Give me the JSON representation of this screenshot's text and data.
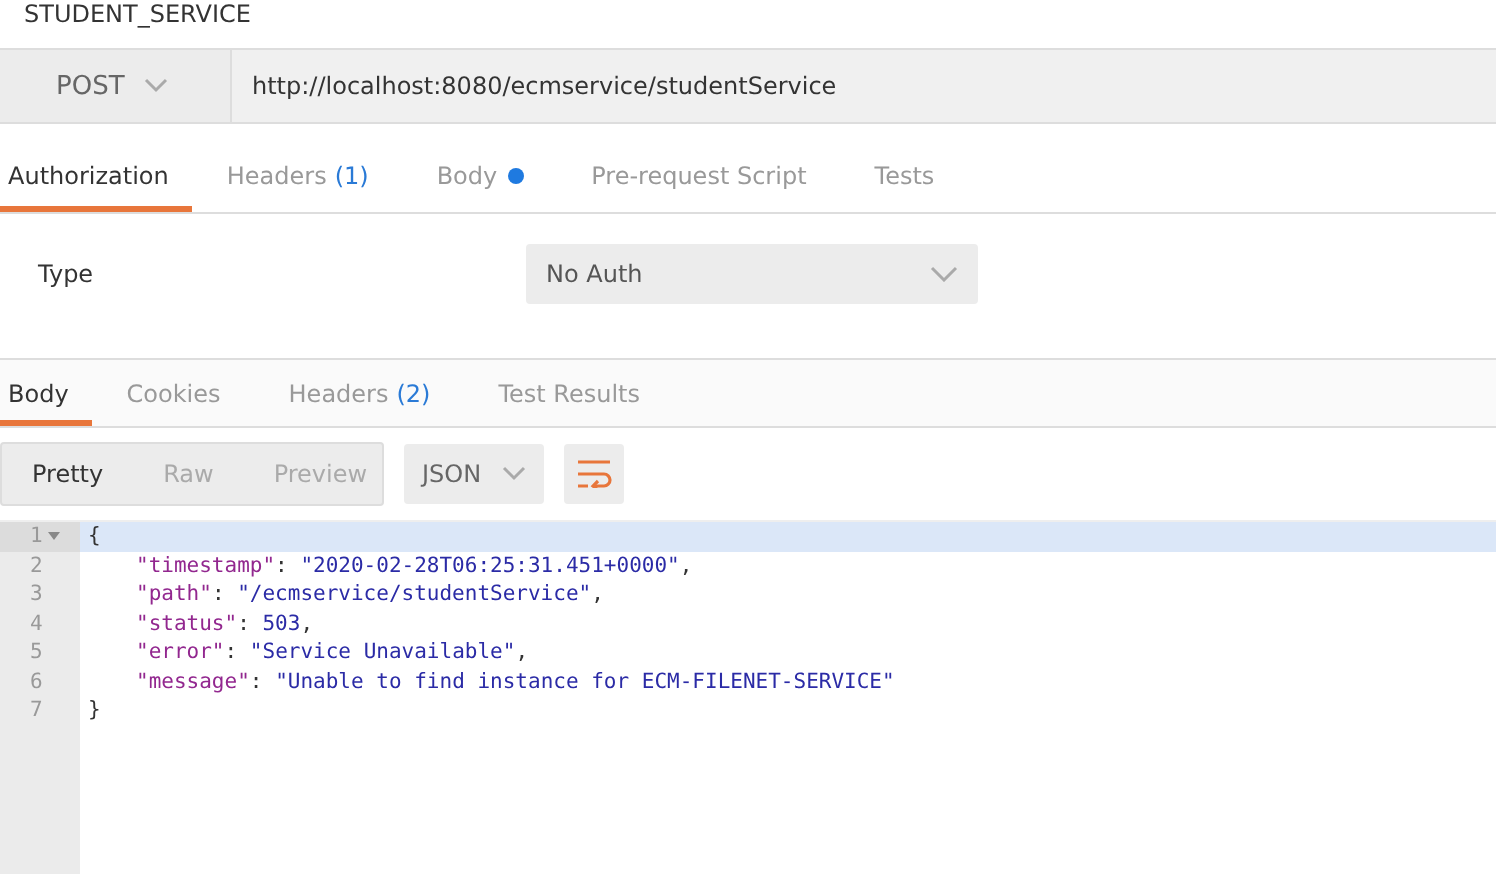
{
  "request_title": "STUDENT_SERVICE",
  "method": "POST",
  "url": "http://localhost:8080/ecmservice/studentService",
  "request_tabs": [
    {
      "label": "Authorization",
      "dot": false,
      "selected": true
    },
    {
      "label": "Headers",
      "count": "(1)",
      "dot": false,
      "selected": false
    },
    {
      "label": "Body",
      "dot": true,
      "selected": false
    },
    {
      "label": "Pre-request Script",
      "dot": false,
      "selected": false
    },
    {
      "label": "Tests",
      "dot": false,
      "selected": false
    }
  ],
  "auth": {
    "label": "Type",
    "value": "No Auth"
  },
  "response_tabs": [
    {
      "label": "Body",
      "selected": true
    },
    {
      "label": "Cookies",
      "selected": false
    },
    {
      "label": "Headers",
      "count": "(2)",
      "selected": false
    },
    {
      "label": "Test Results",
      "selected": false
    }
  ],
  "view_modes": [
    {
      "label": "Pretty",
      "selected": true
    },
    {
      "label": "Raw",
      "selected": false
    },
    {
      "label": "Preview",
      "selected": false
    }
  ],
  "format": "JSON",
  "code_lines": [
    {
      "number": "1",
      "fold": true,
      "highlighted": true,
      "tokens": [
        {
          "kind": "punct",
          "text": "{"
        }
      ]
    },
    {
      "number": "2",
      "fold": false,
      "highlighted": false,
      "tokens": [
        {
          "kind": "key",
          "text": "\"timestamp\""
        },
        {
          "kind": "punct",
          "text": ": "
        },
        {
          "kind": "string",
          "text": "\"2020-02-28T06:25:31.451+0000\""
        },
        {
          "kind": "punct",
          "text": ","
        }
      ]
    },
    {
      "number": "3",
      "fold": false,
      "highlighted": false,
      "tokens": [
        {
          "kind": "key",
          "text": "\"path\""
        },
        {
          "kind": "punct",
          "text": ": "
        },
        {
          "kind": "string",
          "text": "\"/ecmservice/studentService\""
        },
        {
          "kind": "punct",
          "text": ","
        }
      ]
    },
    {
      "number": "4",
      "fold": false,
      "highlighted": false,
      "tokens": [
        {
          "kind": "key",
          "text": "\"status\""
        },
        {
          "kind": "punct",
          "text": ": "
        },
        {
          "kind": "number",
          "text": "503"
        },
        {
          "kind": "punct",
          "text": ","
        }
      ]
    },
    {
      "number": "5",
      "fold": false,
      "highlighted": false,
      "tokens": [
        {
          "kind": "key",
          "text": "\"error\""
        },
        {
          "kind": "punct",
          "text": ": "
        },
        {
          "kind": "string",
          "text": "\"Service Unavailable\""
        },
        {
          "kind": "punct",
          "text": ","
        }
      ]
    },
    {
      "number": "6",
      "fold": false,
      "highlighted": false,
      "tokens": [
        {
          "kind": "key",
          "text": "\"message\""
        },
        {
          "kind": "punct",
          "text": ": "
        },
        {
          "kind": "string",
          "text": "\"Unable to find instance for ECM-FILENET-SERVICE\""
        }
      ]
    },
    {
      "number": "7",
      "fold": false,
      "highlighted": false,
      "tokens": [
        {
          "kind": "punct",
          "text": "}"
        }
      ]
    }
  ]
}
